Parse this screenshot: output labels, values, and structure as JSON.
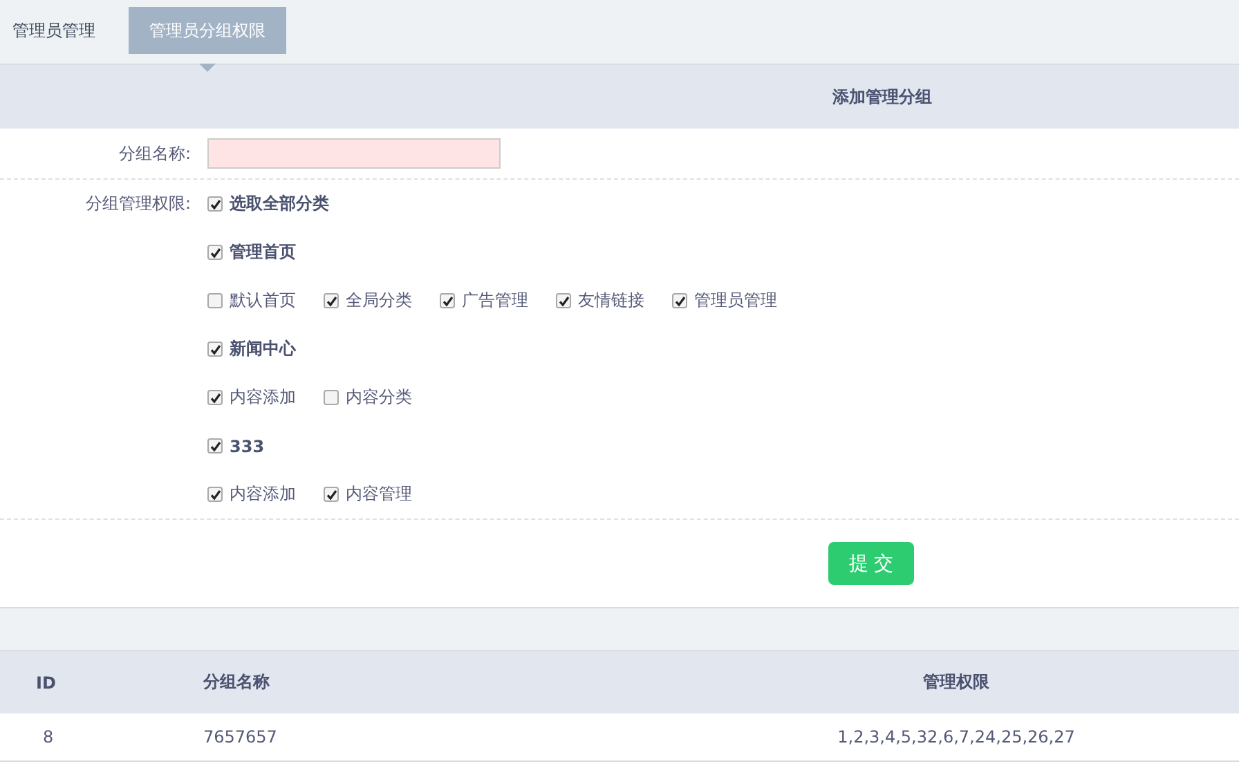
{
  "tabs": [
    {
      "label": "管理员管理",
      "selected": false
    },
    {
      "label": "管理员分组权限",
      "selected": true
    }
  ],
  "form": {
    "title": "添加管理分组",
    "name_label": "分组名称:",
    "permissions_label": "分组管理权限:",
    "select_all": {
      "label": "选取全部分类",
      "checked": true
    },
    "groups": [
      {
        "label": "管理首页",
        "checked": true,
        "children": [
          {
            "label": "默认首页",
            "checked": false
          },
          {
            "label": "全局分类",
            "checked": true
          },
          {
            "label": "广告管理",
            "checked": true
          },
          {
            "label": "友情链接",
            "checked": true
          },
          {
            "label": "管理员管理",
            "checked": true
          }
        ]
      },
      {
        "label": "新闻中心",
        "checked": true,
        "children": [
          {
            "label": "内容添加",
            "checked": true
          },
          {
            "label": "内容分类",
            "checked": false
          }
        ]
      },
      {
        "label": "333",
        "checked": true,
        "children": [
          {
            "label": "内容添加",
            "checked": true
          },
          {
            "label": "内容管理",
            "checked": true
          }
        ]
      }
    ],
    "submit": "提 交"
  },
  "table": {
    "columns": [
      "ID",
      "分组名称",
      "管理权限"
    ],
    "rows": [
      [
        "8",
        "7657657",
        "1,2,3,4,5,32,6,7,24,25,26,27"
      ]
    ]
  }
}
